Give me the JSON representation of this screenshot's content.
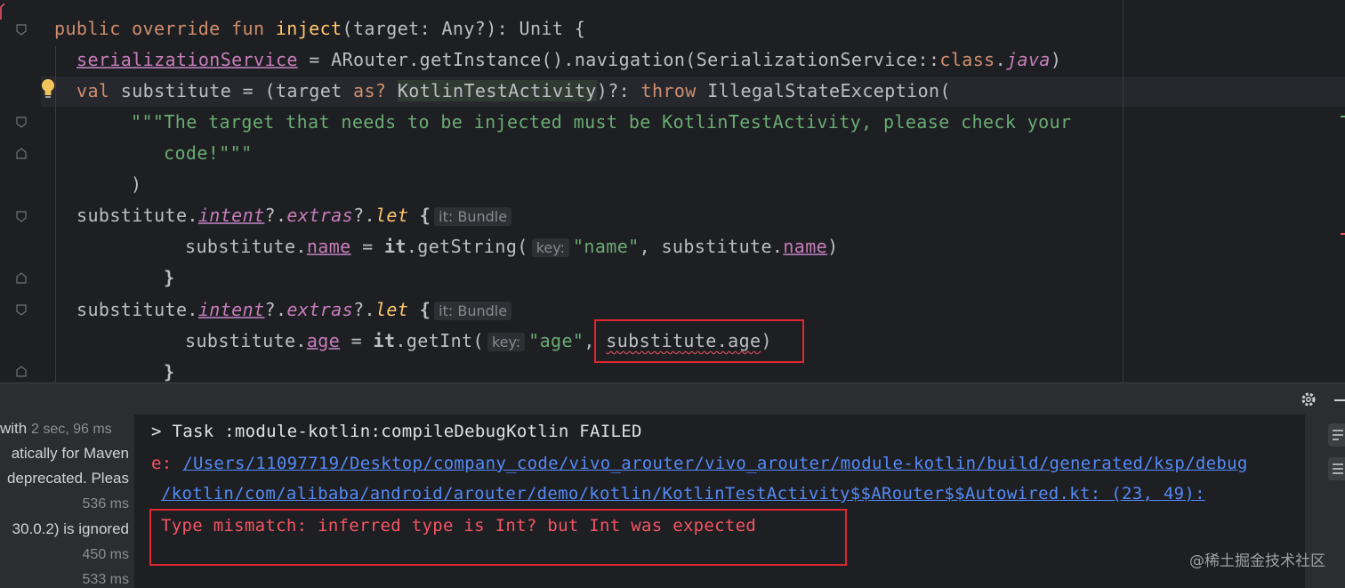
{
  "editor": {
    "lines": {
      "l1": {
        "kw1": "public override fun ",
        "fn": "inject",
        "rest": "(target: Any?): Unit {"
      },
      "l2": {
        "prop": "serializationService",
        "eq": " = ARouter.getInstance().navigation(SerializationService::",
        "kw": "class",
        "dot": ".",
        "javaprop": "java",
        "close": ")"
      },
      "l3": {
        "kw": "val ",
        "a": "substitute = (target ",
        "as": "as?",
        "b": " ",
        "cls": "KotlinTestActivity",
        "c": ")?: ",
        "throw": "throw",
        "d": " IllegalStateException("
      },
      "l4": {
        "str": "\"\"\"The target that needs to be injected must be KotlinTestActivity, please check your"
      },
      "l5": {
        "str": "code!\"\"\""
      },
      "l6": {
        "text": ")"
      },
      "l7": {
        "a": "substitute.",
        "intent": "intent",
        "b": "?.",
        "extras": "extras",
        "c": "?.",
        "let": "let",
        "d": " {",
        "hint": "it: Bundle"
      },
      "l8": {
        "a": "substitute.",
        "name1": "name",
        "b": " = ",
        "it": "it",
        "c": ".getString(",
        "hint": "key:",
        "str": "\"name\"",
        "d": ", substitute.",
        "name2": "name",
        "e": ")"
      },
      "l9": {
        "text": "}"
      },
      "l10": {
        "a": "substitute.",
        "intent": "intent",
        "b": "?.",
        "extras": "extras",
        "c": "?.",
        "let": "let",
        "d": " {",
        "hint": "it: Bundle"
      },
      "l11": {
        "a": "substitute.",
        "age1": "age",
        "b": " = ",
        "it": "it",
        "c": ".getInt(",
        "hint": "key:",
        "str": "\"age\"",
        "d": ", ",
        "err": "substitute.age",
        "e": ")"
      },
      "l12": {
        "text": "}"
      }
    }
  },
  "left_pane": {
    "rows": [
      "with ",
      "2 sec, 96 ms",
      "atically for Maven",
      "deprecated. Pleas",
      "536 ms",
      "30.0.2) is ignored",
      "450 ms",
      "533 ms"
    ]
  },
  "console": {
    "task": "> Task :module-kotlin:compileDebugKotlin FAILED",
    "err_prefix": "e: ",
    "path1": "/Users/11097719/Desktop/company_code/vivo_arouter/vivo_arouter/module-kotlin/build/generated/ksp/debug",
    "path2": "/kotlin/com/alibaba/android/arouter/demo/kotlin/KotlinTestActivity$$ARouter$$Autowired.kt: (23, 49):",
    "message": "Type mismatch: inferred type is Int? but Int was expected"
  },
  "icons": [
    "gear-icon",
    "minimize-icon",
    "bulb-icon",
    "fold-icon"
  ],
  "watermark": "@稀土掘金技术社区",
  "colors": {
    "keyword": "#cf8e6d",
    "function": "#56a8f5",
    "property": "#c77dbb",
    "string": "#6aab73",
    "error": "#f75464",
    "link": "#548af7",
    "highlight_box": "#e0262f"
  }
}
